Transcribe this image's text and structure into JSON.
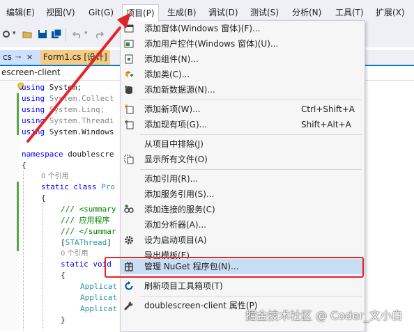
{
  "menubar": {
    "items": [
      "编辑(E)",
      "视图(V)",
      "Git(G)",
      "项目(P)",
      "生成(B)",
      "调试(D)",
      "测试(S)",
      "分析(N)",
      "工具(T)",
      "扩展(X)"
    ],
    "active_index": 3
  },
  "tabs": {
    "first": "cs",
    "second": "Form1.cs [设计]"
  },
  "navbar": {
    "project": "escreen-client"
  },
  "code": {
    "lines": [
      {
        "kw": "using",
        "rest": " System;"
      },
      {
        "kw": "using",
        "rest": " System.Collect"
      },
      {
        "kw": "using",
        "rest": " System.Linq;"
      },
      {
        "kw": "using",
        "rest": " System.Threadi"
      },
      {
        "kw": "using",
        "rest": " System.Windows"
      }
    ],
    "namespace_kw": "namespace",
    "namespace_name": " doublescre",
    "brace_open": "{",
    "refs_0": "0 个引用",
    "static_class_kw": "static class",
    "class_name": " Pro",
    "brace_open2": "{",
    "summary_open": "/// <summary",
    "summary_text": "/// 应用程序",
    "summary_close": "/// </summar",
    "attr_open": "[",
    "attr_name": "STAThread",
    "attr_close": "]",
    "refs_1": "0 个引用",
    "static_void_kw": "static void",
    "brace_open3": "{",
    "app_lines": [
      "Applicat",
      "Applicat",
      "Applicat"
    ],
    "brace_close": "}"
  },
  "context_menu": {
    "items": [
      {
        "label": "添加窗体(Windows 窗体)(F)...",
        "shortcut": "",
        "icon": "form-icon"
      },
      {
        "label": "添加用户控件(Windows 窗体)(U)...",
        "shortcut": "",
        "icon": "user-control-icon"
      },
      {
        "label": "添加组件(N)...",
        "shortcut": "",
        "icon": "component-icon"
      },
      {
        "label": "添加类(C)...",
        "shortcut": "",
        "icon": "class-icon"
      },
      {
        "label": "添加新数据源(N)...",
        "shortcut": "",
        "icon": "data-source-icon"
      },
      {
        "label": "添加新项(W)...",
        "shortcut": "Ctrl+Shift+A",
        "icon": "new-item-icon"
      },
      {
        "label": "添加现有项(G)...",
        "shortcut": "Shift+Alt+A",
        "icon": "existing-item-icon"
      },
      {
        "label": "从项目中排除(J)",
        "shortcut": "",
        "icon": ""
      },
      {
        "label": "显示所有文件(O)",
        "shortcut": "",
        "icon": "show-all-files-icon"
      },
      {
        "label": "添加引用(R)...",
        "shortcut": "",
        "icon": ""
      },
      {
        "label": "添加服务引用(S)...",
        "shortcut": "",
        "icon": ""
      },
      {
        "label": "添加连接的服务(C)",
        "shortcut": "",
        "icon": "connected-service-icon"
      },
      {
        "label": "添加分析器(A)...",
        "shortcut": "",
        "icon": ""
      },
      {
        "label": "设为启动项目(A)",
        "shortcut": "",
        "icon": "gear-icon"
      },
      {
        "label": "导出模板(E)...",
        "shortcut": "",
        "icon": ""
      },
      {
        "label": "管理 NuGet 程序包(N)...",
        "shortcut": "",
        "icon": "nuget-icon"
      },
      {
        "label": "刷新项目工具箱项(T)",
        "shortcut": "",
        "icon": "refresh-icon"
      },
      {
        "label": "doublescreen-client 属性(P)",
        "shortcut": "",
        "icon": "wrench-icon"
      }
    ],
    "highlighted_index": 15
  },
  "watermark": "掘金技术社区 @ Coder_文小白",
  "colors": {
    "menubar_bg": "#eef0f6",
    "menu_bg": "#f6f6f6",
    "highlight": "#c9def5",
    "red_annotation": "#e2232a",
    "keyword": "#0000ff",
    "type": "#2b91af",
    "comment": "#008000"
  }
}
